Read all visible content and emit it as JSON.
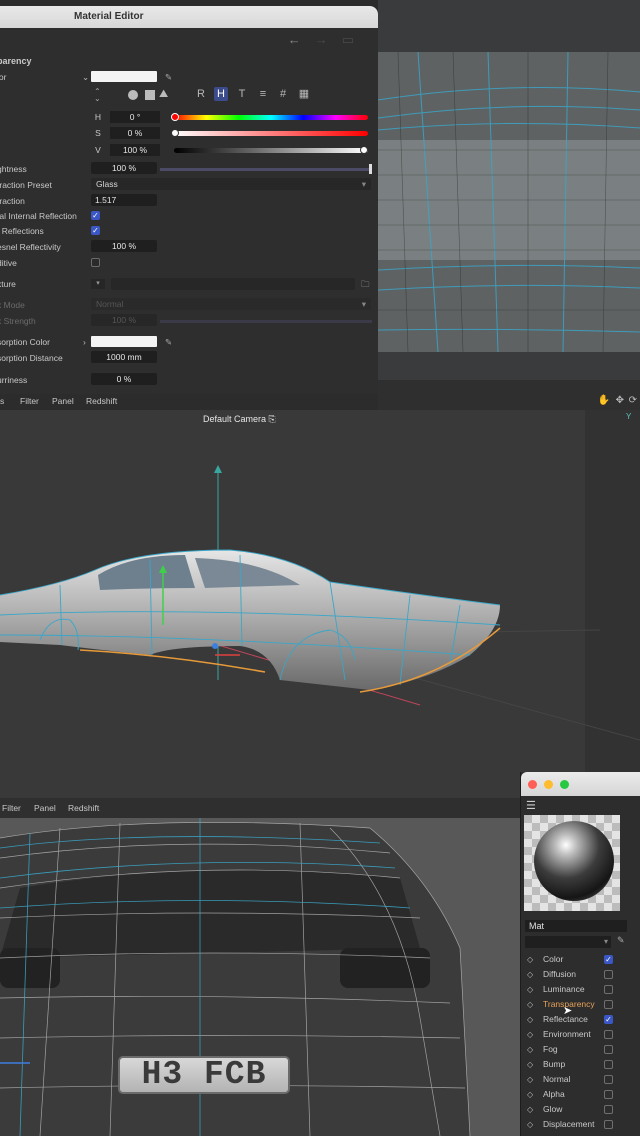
{
  "material_editor": {
    "title": "Material Editor",
    "section": "Transparency",
    "section_visible": "parency",
    "labels": {
      "color": "lor",
      "brightness": "ghtness",
      "refraction_preset": "fraction Preset",
      "refraction": "fraction",
      "tir": "tal Internal Reflection",
      "exit_reflections": "t Reflections",
      "fresnel": "esnel Reflectivity",
      "additive": "ditive",
      "texture": "xture",
      "mix_mode": "x Mode",
      "mix_strength": "x Strength",
      "absorption_color": "sorption Color",
      "absorption_distance": "sorption Distance",
      "blurriness": "urriness"
    },
    "hsv": {
      "h_label": "H",
      "s_label": "S",
      "v_label": "V",
      "h": "0 °",
      "s": "0 %",
      "v": "100 %"
    },
    "values": {
      "brightness": "100 %",
      "refraction_preset": "Glass",
      "refraction": "1.517",
      "fresnel": "100 %",
      "mix_mode": "Normal",
      "mix_strength": "100 %",
      "absorption_distance": "1000 mm",
      "blurriness": "0 %"
    },
    "checkboxes": {
      "tir": true,
      "exit_reflections": true,
      "additive": false
    },
    "mode_buttons": [
      "R",
      "H",
      "T",
      "≡",
      "#",
      "▦"
    ],
    "menu": [
      "s",
      "Filter",
      "Panel",
      "Redshift"
    ]
  },
  "viewport": {
    "camera_label": "Default Camera",
    "axis_label": "Y"
  },
  "bottom_viewport": {
    "menu": [
      "Filter",
      "Panel",
      "Redshift"
    ],
    "plate_text": "H3 FCB"
  },
  "material_manager": {
    "material_name": "Mat",
    "channels": [
      {
        "name": "Color",
        "checked": true
      },
      {
        "name": "Diffusion",
        "checked": false
      },
      {
        "name": "Luminance",
        "checked": false
      },
      {
        "name": "Transparency",
        "checked": false,
        "active": true
      },
      {
        "name": "Reflectance",
        "checked": true
      },
      {
        "name": "Environment",
        "checked": false
      },
      {
        "name": "Fog",
        "checked": false
      },
      {
        "name": "Bump",
        "checked": false
      },
      {
        "name": "Normal",
        "checked": false
      },
      {
        "name": "Alpha",
        "checked": false
      },
      {
        "name": "Glow",
        "checked": false
      },
      {
        "name": "Displacement",
        "checked": false
      }
    ]
  },
  "colors": {
    "accent": "#3b57c6",
    "active_channel": "#e8a25a",
    "wire": "#3aa6c8"
  }
}
